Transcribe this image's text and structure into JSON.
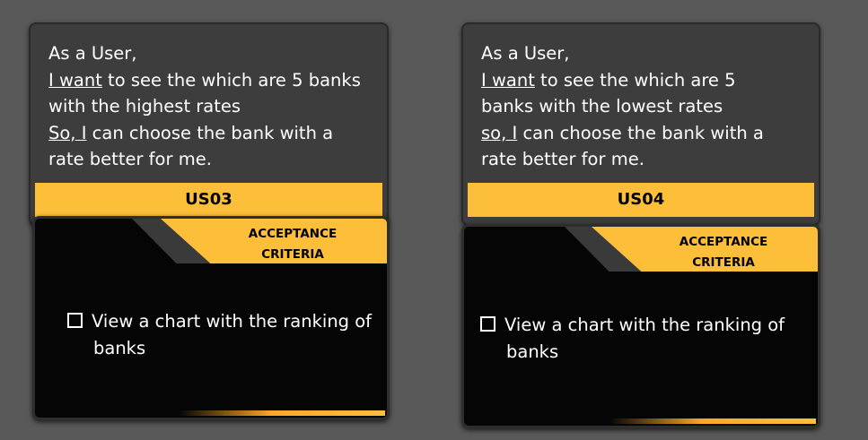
{
  "cards": [
    {
      "line1": "As a User,",
      "want_label": "I want",
      "want_rest": " to see the which are 5 banks",
      "line3": "with the highest rates",
      "so_label": "So, I",
      "so_rest": " can choose the bank with a",
      "line5": "rate better for me.",
      "id": "US03",
      "acceptance_line1": "ACCEPTANCE",
      "acceptance_line2": "CRITERIA",
      "criterion_line1": "View a chart with the ranking of",
      "criterion_line2": "banks"
    },
    {
      "line1": "As a User,",
      "want_label": "I want",
      "want_rest": " to see the which are 5",
      "line3": "banks with the lowest rates",
      "so_label": "so, I",
      "so_rest": " can choose the bank with a",
      "line5": "rate better for me.",
      "id": "US04",
      "acceptance_line1": "ACCEPTANCE",
      "acceptance_line2": "CRITERIA",
      "criterion_line1": "View a chart with the ranking of",
      "criterion_line2": "banks"
    }
  ],
  "colors": {
    "background": "#595959",
    "card": "#3d3d3d",
    "accent": "#fdbf3a",
    "panel": "#050505"
  }
}
